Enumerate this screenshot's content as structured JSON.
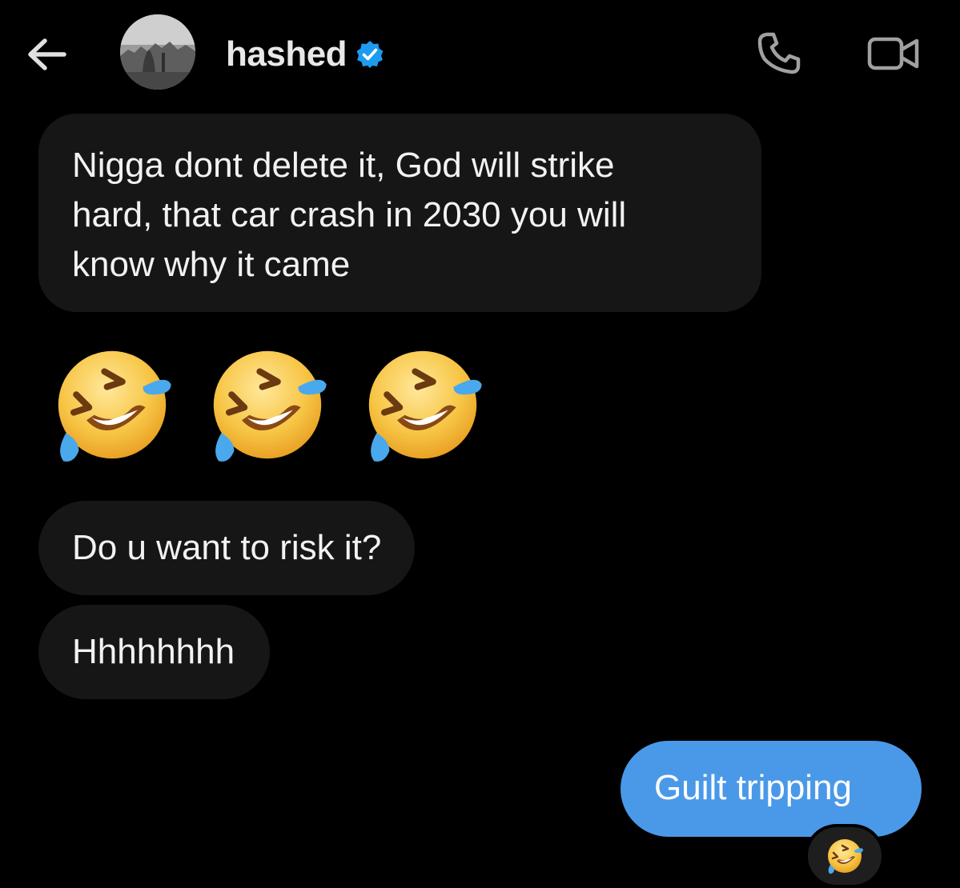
{
  "header": {
    "back_icon": "arrow-left-icon",
    "avatar": "profile-photo-grayscale",
    "username": "hashed",
    "verified_icon": "verified-badge-icon",
    "call_icon": "phone-icon",
    "video_icon": "video-camera-icon"
  },
  "messages": [
    {
      "side": "received",
      "text": "Nigga dont delete it, God will strike\nhard, that car crash in 2030 you will\nknow why it came"
    },
    {
      "side": "received",
      "emoji": [
        "rolling-on-the-floor-laughing",
        "rolling-on-the-floor-laughing",
        "rolling-on-the-floor-laughing"
      ]
    },
    {
      "side": "received",
      "text": "Do u want to risk it?"
    },
    {
      "side": "received",
      "text": "Hhhhhhhh"
    },
    {
      "side": "sent",
      "text": "Guilt tripping",
      "reaction": "rolling-on-the-floor-laughing"
    }
  ],
  "colors": {
    "background": "#000000",
    "received_bubble": "#161616",
    "sent_bubble": "#4a99e9",
    "verified_badge": "#1d9bf0",
    "icon_gray": "#a0a0a0"
  }
}
